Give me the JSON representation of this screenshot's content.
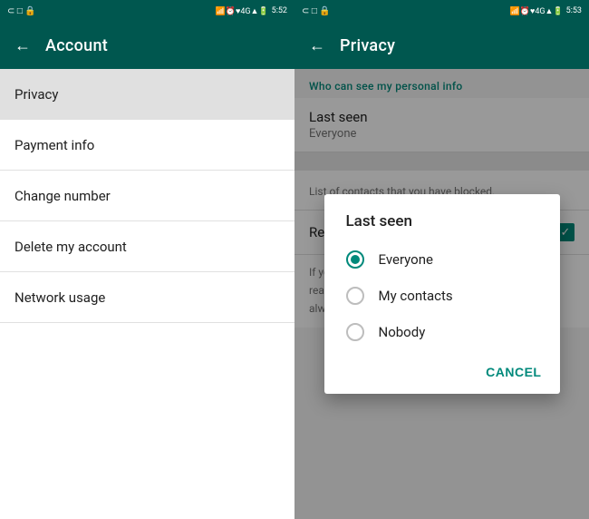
{
  "left": {
    "statusBar": {
      "left": "⊂ □ 🔒",
      "time": "5:52",
      "rightIcons": "📶 ⏰ ▽ 4G▲ 📶 🔋"
    },
    "toolbar": {
      "backLabel": "←",
      "title": "Account"
    },
    "menuItems": [
      {
        "label": "Privacy",
        "highlighted": true
      },
      {
        "label": "Payment info",
        "highlighted": false
      },
      {
        "label": "Change number",
        "highlighted": false
      },
      {
        "label": "Delete my account",
        "highlighted": false
      },
      {
        "label": "Network usage",
        "highlighted": false
      }
    ]
  },
  "right": {
    "statusBar": {
      "left": "⊂ □ 🔒",
      "time": "5:53",
      "rightIcons": "📶 ⏰ ▽ 4G▲ 📶 🔋"
    },
    "toolbar": {
      "backLabel": "←",
      "title": "Privacy"
    },
    "sectionHeader": "Who can see my personal info",
    "lastSeenItem": {
      "title": "Last seen",
      "subtitle": "Everyone"
    },
    "dialog": {
      "title": "Last seen",
      "options": [
        {
          "label": "Everyone",
          "selected": true
        },
        {
          "label": "My contacts",
          "selected": false
        },
        {
          "label": "Nobody",
          "selected": false
        }
      ],
      "cancelLabel": "CANCEL"
    },
    "blockedText": "List of contacts that you have blocked.",
    "readReceiptsItem": {
      "title": "Read receipts",
      "checked": true
    },
    "readReceiptsDesc": "If you turn off read receipts, you won't be able to see read receipts from other people. Read receipts are always sent for group chats."
  }
}
